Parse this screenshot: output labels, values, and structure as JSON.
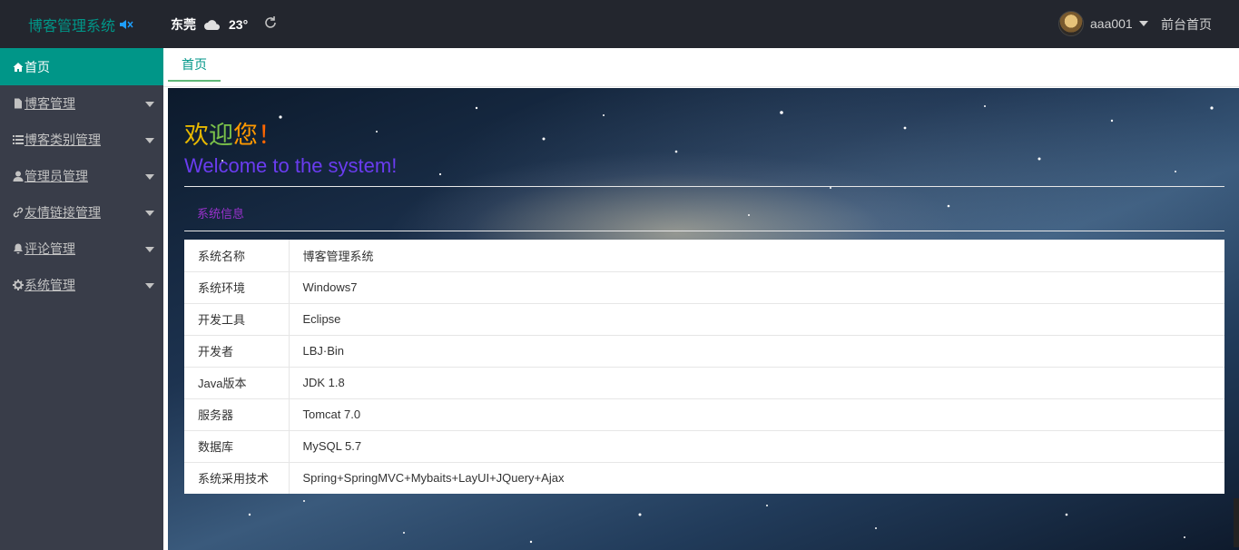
{
  "header": {
    "logo": "博客管理系统",
    "city": "东莞",
    "temperature": "23°",
    "username": "aaa001",
    "front_link": "前台首页"
  },
  "sidebar": {
    "items": [
      {
        "label": "首页",
        "icon": "home-icon",
        "active": true
      },
      {
        "label": "博客管理",
        "icon": "file-icon"
      },
      {
        "label": "博客类别管理",
        "icon": "list-icon"
      },
      {
        "label": "管理员管理",
        "icon": "user-icon"
      },
      {
        "label": "友情链接管理",
        "icon": "link-icon"
      },
      {
        "label": "评论管理",
        "icon": "bell-icon"
      },
      {
        "label": "系统管理",
        "icon": "gear-icon"
      }
    ]
  },
  "tabs": [
    {
      "label": "首页"
    }
  ],
  "main": {
    "welcome_cn": [
      "欢",
      "迎",
      "您",
      "！"
    ],
    "welcome_cn_colors": [
      "#e6b800",
      "#7cc34a",
      "#ff9900",
      "#ff6600"
    ],
    "welcome_en": "Welcome to the system!",
    "section_title": "系统信息",
    "rows": [
      {
        "key": "系统名称",
        "value": "博客管理系统"
      },
      {
        "key": "系统环境",
        "value": "Windows7"
      },
      {
        "key": "开发工具",
        "value": "Eclipse"
      },
      {
        "key": "开发者",
        "value": "LBJ·Bin"
      },
      {
        "key": "Java版本",
        "value": "JDK 1.8"
      },
      {
        "key": "服务器",
        "value": "Tomcat 7.0"
      },
      {
        "key": "数据库",
        "value": "MySQL 5.7"
      },
      {
        "key": "系统采用技术",
        "value": "Spring+SpringMVC+Mybaits+LayUI+JQuery+Ajax"
      }
    ]
  },
  "colors": {
    "accent": "#009688",
    "header_bg": "#23262e",
    "sidebar_bg": "#393d49"
  }
}
